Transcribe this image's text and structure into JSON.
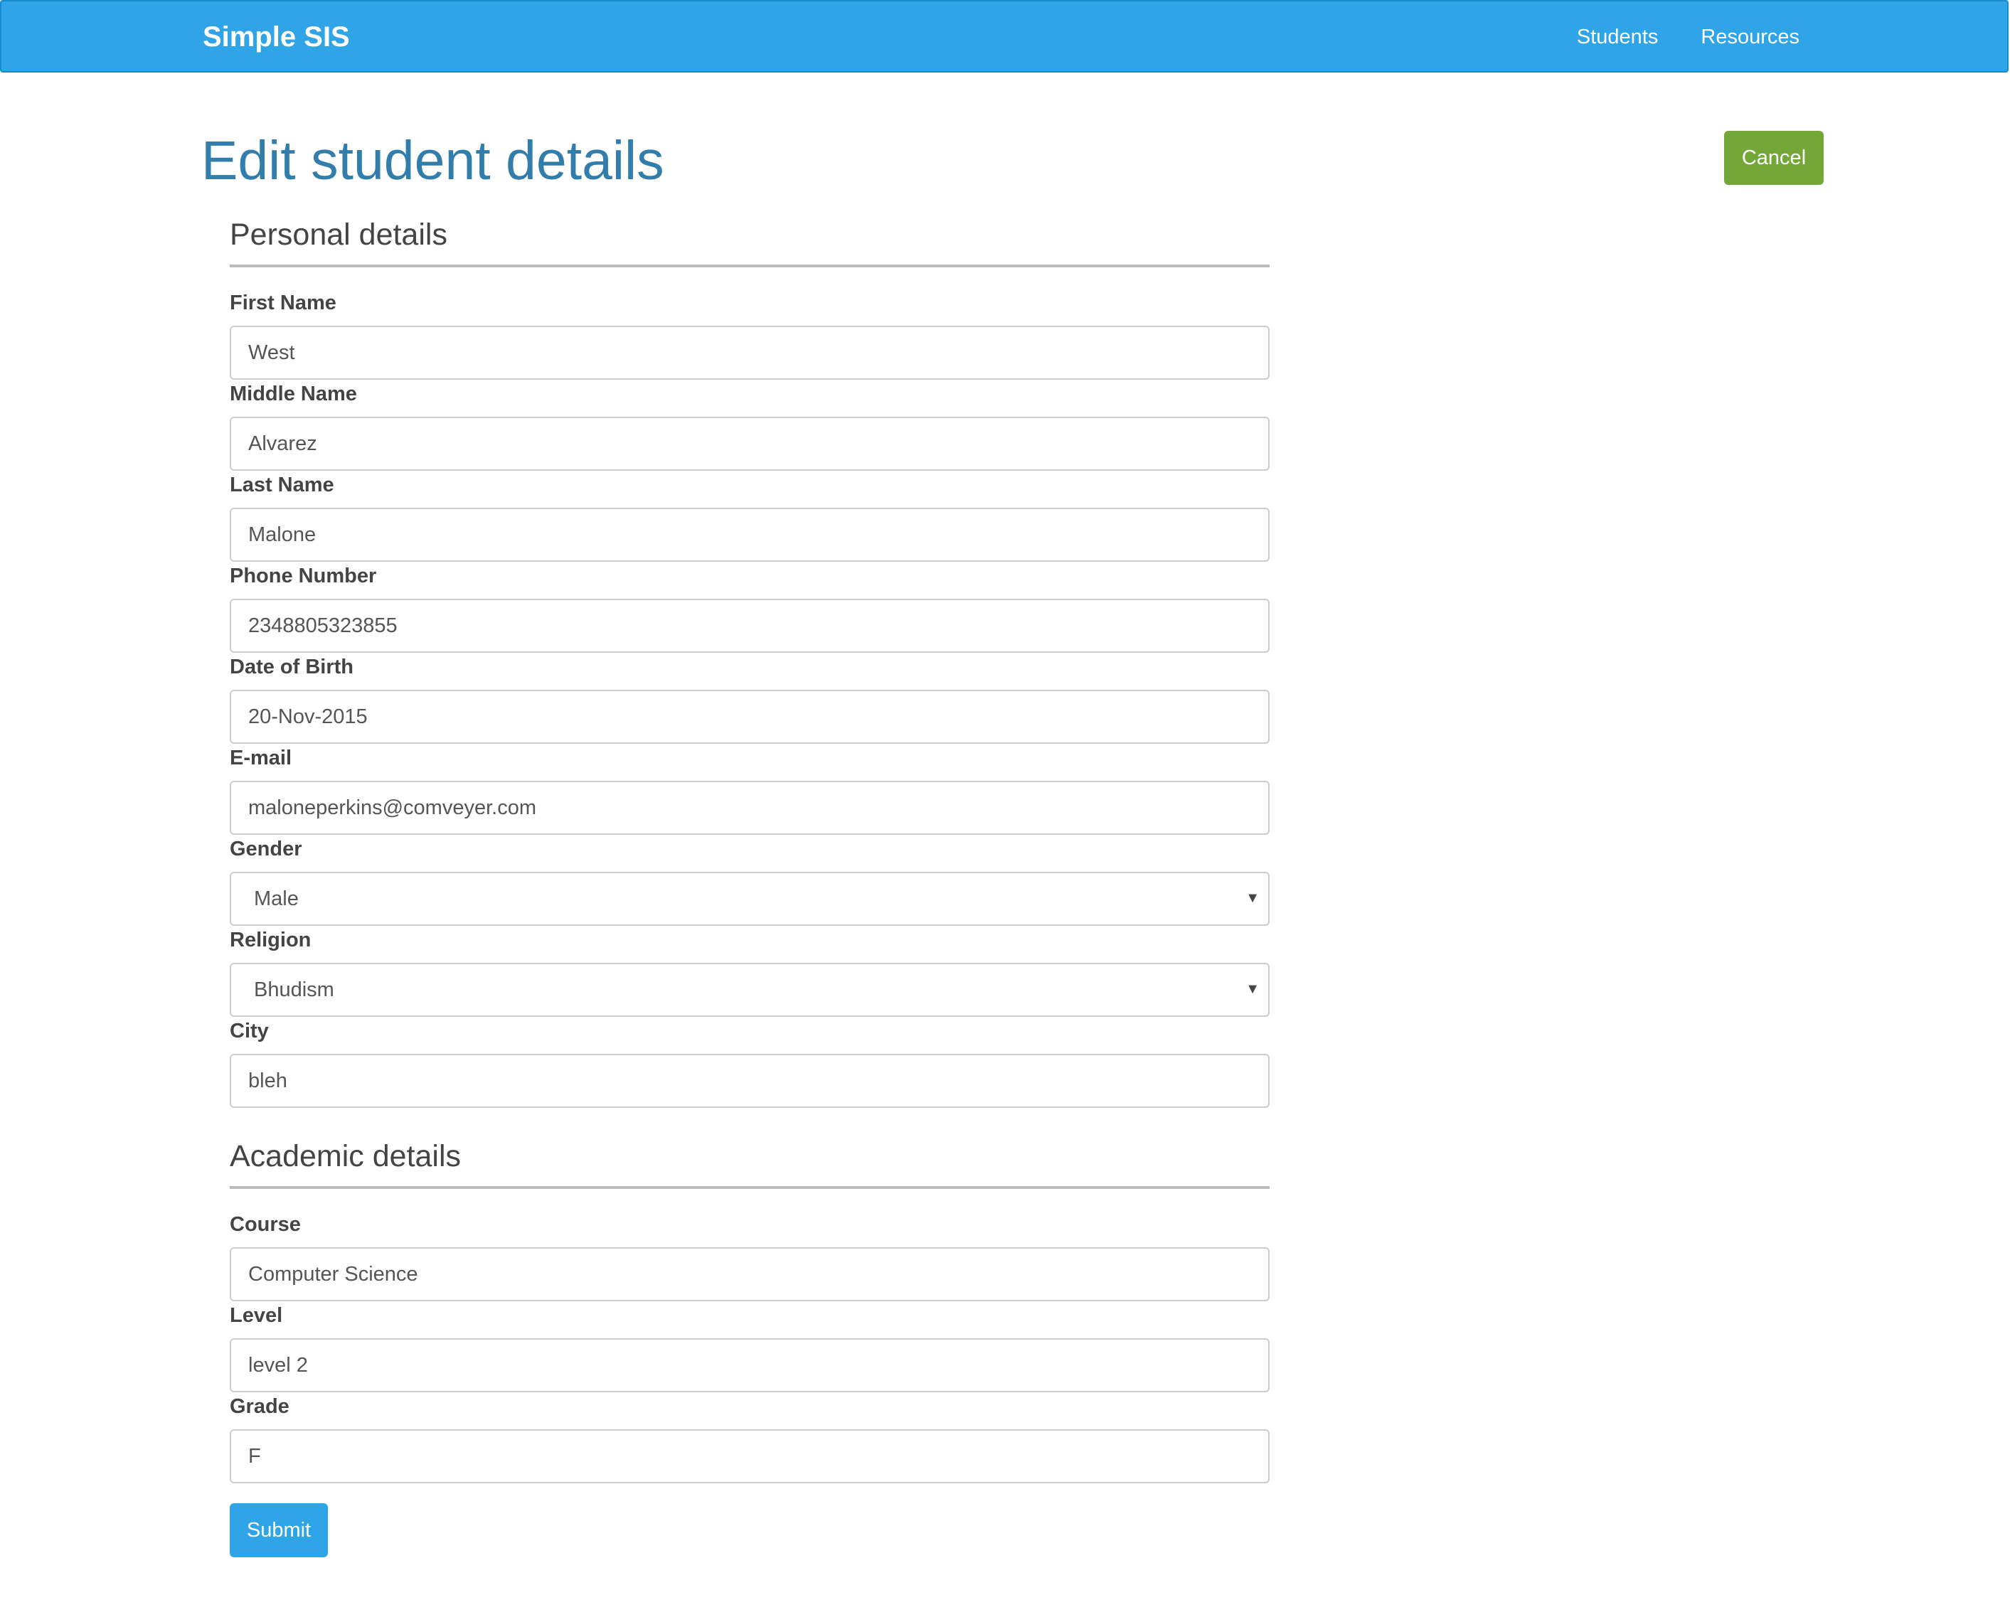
{
  "navbar": {
    "brand": "Simple SIS",
    "links": [
      {
        "label": "Students"
      },
      {
        "label": "Resources"
      }
    ]
  },
  "page": {
    "title": "Edit student details",
    "cancel_label": "Cancel",
    "submit_label": "Submit"
  },
  "personal": {
    "legend": "Personal details",
    "fields": {
      "first_name": {
        "label": "First Name",
        "value": "West"
      },
      "middle_name": {
        "label": "Middle Name",
        "value": "Alvarez"
      },
      "last_name": {
        "label": "Last Name",
        "value": "Malone"
      },
      "phone": {
        "label": "Phone Number",
        "value": "2348805323855"
      },
      "dob": {
        "label": "Date of Birth",
        "value": "20-Nov-2015"
      },
      "email": {
        "label": "E-mail",
        "value": "maloneperkins@comveyer.com"
      },
      "gender": {
        "label": "Gender",
        "selected": "Male"
      },
      "religion": {
        "label": "Religion",
        "selected": "Bhudism"
      },
      "city": {
        "label": "City",
        "value": "bleh"
      }
    }
  },
  "academic": {
    "legend": "Academic details",
    "fields": {
      "course": {
        "label": "Course",
        "value": "Computer Science"
      },
      "level": {
        "label": "Level",
        "value": "level 2"
      },
      "grade": {
        "label": "Grade",
        "value": "F"
      }
    }
  },
  "colors": {
    "navbar": "#2fa4e7",
    "title": "#317eac",
    "cancel": "#73a839",
    "submit": "#2fa4e7"
  },
  "icons": {
    "select_caret": "chevron-down-icon"
  }
}
